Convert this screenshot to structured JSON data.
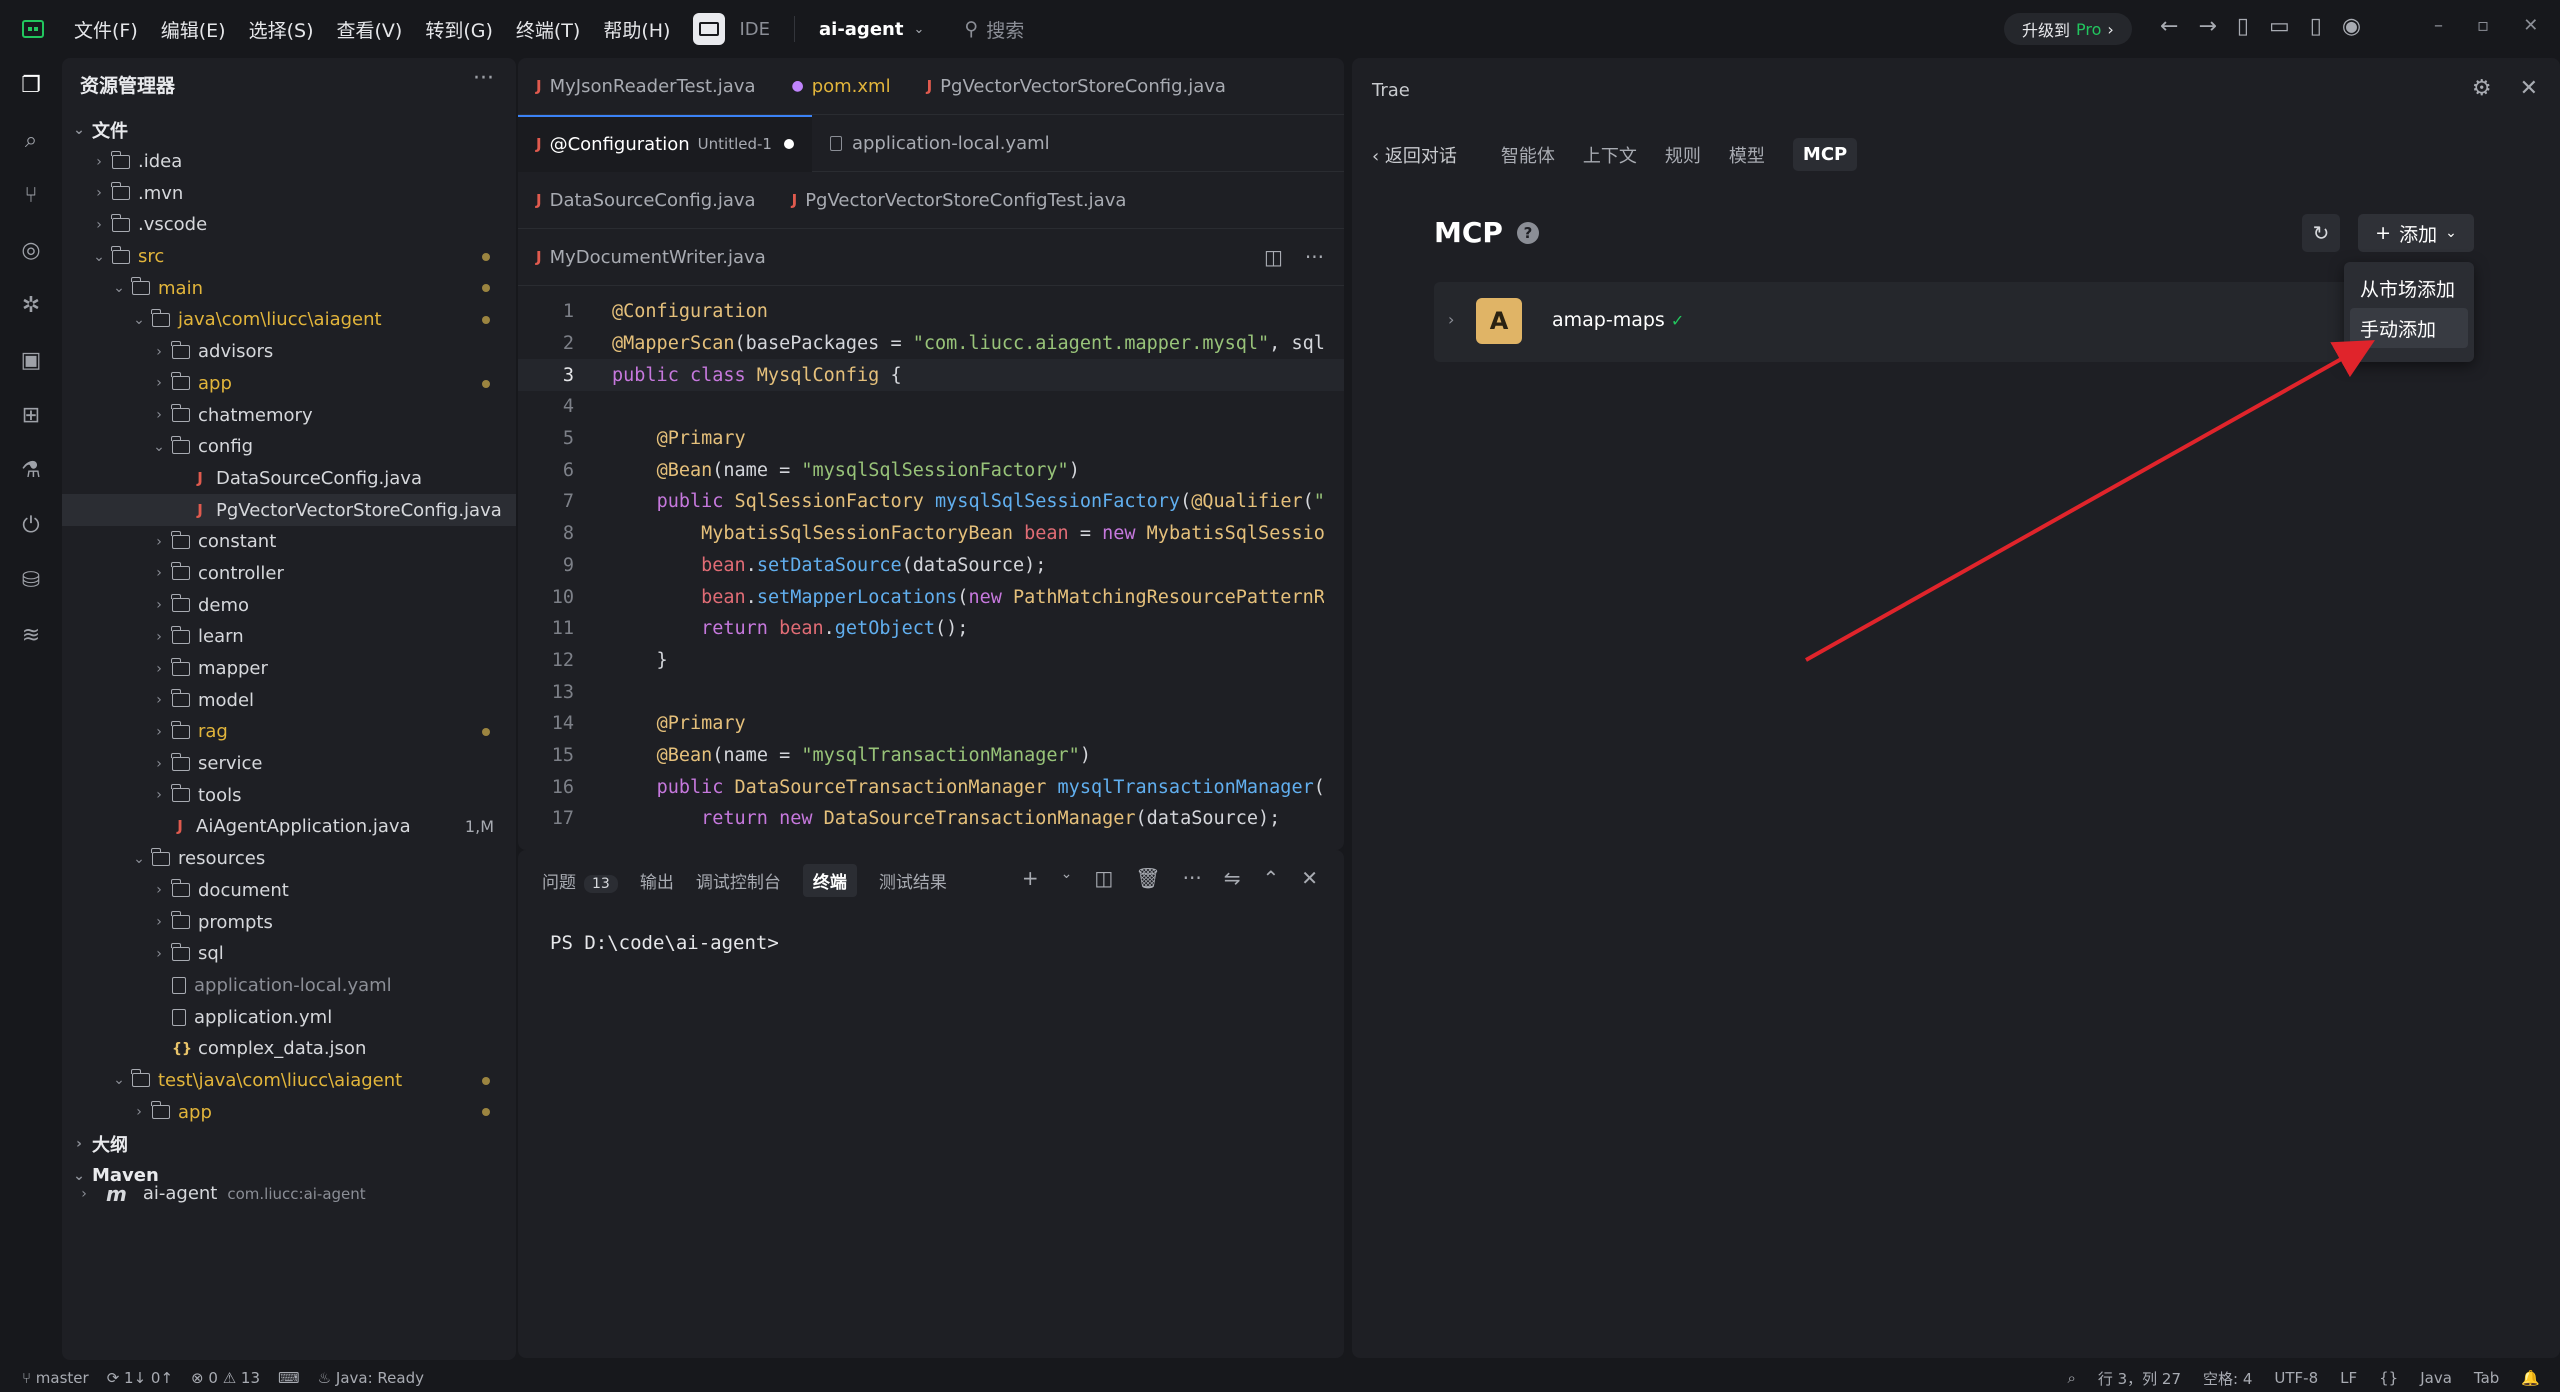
{
  "menu": {
    "items": [
      "文件(F)",
      "编辑(E)",
      "选择(S)",
      "查看(V)",
      "转到(G)",
      "终端(T)",
      "帮助(H)"
    ],
    "ide_label": "IDE",
    "project": "ai-agent",
    "search": "搜索",
    "upgrade_prefix": "升级到",
    "upgrade_pro": "Pro"
  },
  "explorer": {
    "title": "资源管理器",
    "more": "···"
  },
  "tree": [
    {
      "d": 0,
      "c": "⌄",
      "i": "",
      "t": "文件",
      "cls": "sec-row"
    },
    {
      "d": 1,
      "c": "›",
      "i": "fold",
      "t": ".idea"
    },
    {
      "d": 1,
      "c": "›",
      "i": "fold",
      "t": ".mvn"
    },
    {
      "d": 1,
      "c": "›",
      "i": "fold",
      "t": ".vscode"
    },
    {
      "d": 1,
      "c": "⌄",
      "i": "fold",
      "t": "src",
      "cls": "yel",
      "dot": true
    },
    {
      "d": 2,
      "c": "⌄",
      "i": "fold",
      "t": "main",
      "cls": "yel",
      "dot": true
    },
    {
      "d": 3,
      "c": "⌄",
      "i": "fold",
      "t": "java\\com\\liucc\\aiagent",
      "cls": "yel",
      "dot": true
    },
    {
      "d": 4,
      "c": "›",
      "i": "fold",
      "t": "advisors"
    },
    {
      "d": 4,
      "c": "›",
      "i": "fold",
      "t": "app",
      "cls": "yel",
      "dot": true
    },
    {
      "d": 4,
      "c": "›",
      "i": "fold",
      "t": "chatmemory"
    },
    {
      "d": 4,
      "c": "⌄",
      "i": "fold",
      "t": "config"
    },
    {
      "d": 5,
      "c": "",
      "i": "java",
      "t": "DataSourceConfig.java"
    },
    {
      "d": 5,
      "c": "",
      "i": "java",
      "t": "PgVectorVectorStoreConfig.java",
      "sel": true
    },
    {
      "d": 4,
      "c": "›",
      "i": "fold",
      "t": "constant"
    },
    {
      "d": 4,
      "c": "›",
      "i": "fold",
      "t": "controller"
    },
    {
      "d": 4,
      "c": "›",
      "i": "fold",
      "t": "demo"
    },
    {
      "d": 4,
      "c": "›",
      "i": "fold",
      "t": "learn"
    },
    {
      "d": 4,
      "c": "›",
      "i": "fold",
      "t": "mapper"
    },
    {
      "d": 4,
      "c": "›",
      "i": "fold",
      "t": "model"
    },
    {
      "d": 4,
      "c": "›",
      "i": "fold",
      "t": "rag",
      "cls": "yel",
      "dot": true
    },
    {
      "d": 4,
      "c": "›",
      "i": "fold",
      "t": "service"
    },
    {
      "d": 4,
      "c": "›",
      "i": "fold",
      "t": "tools"
    },
    {
      "d": 4,
      "c": "",
      "i": "java",
      "t": "AiAgentApplication.java",
      "badge": "1,M"
    },
    {
      "d": 3,
      "c": "⌄",
      "i": "fold",
      "t": "resources"
    },
    {
      "d": 4,
      "c": "›",
      "i": "fold",
      "t": "document"
    },
    {
      "d": 4,
      "c": "›",
      "i": "fold",
      "t": "prompts"
    },
    {
      "d": 4,
      "c": "›",
      "i": "fold",
      "t": "sql"
    },
    {
      "d": 4,
      "c": "",
      "i": "file",
      "t": "application-local.yaml",
      "cls": "dim"
    },
    {
      "d": 4,
      "c": "",
      "i": "file",
      "t": "application.yml"
    },
    {
      "d": 4,
      "c": "",
      "i": "json",
      "t": "complex_data.json"
    },
    {
      "d": 2,
      "c": "⌄",
      "i": "fold",
      "t": "test\\java\\com\\liucc\\aiagent",
      "cls": "yel",
      "dot": true
    },
    {
      "d": 3,
      "c": "›",
      "i": "fold",
      "t": "app",
      "cls": "yel",
      "dot": true
    },
    {
      "d": 0,
      "c": "›",
      "i": "",
      "t": "大纲",
      "cls": "sec-row"
    },
    {
      "d": 0,
      "c": "⌄",
      "i": "",
      "t": "Maven",
      "cls": "sec-row"
    }
  ],
  "maven": {
    "name": "ai-agent",
    "coord": "com.liucc:ai-agent"
  },
  "editor": {
    "tabs_row1": [
      {
        "label": "MyJsonReaderTest.java",
        "icon": "java"
      },
      {
        "label": "pom.xml",
        "icon": "pom",
        "yellow": true
      },
      {
        "label": "PgVectorVectorStoreConfig.java",
        "icon": "java"
      }
    ],
    "tabs_row2": [
      {
        "label": "@Configuration",
        "sub": "Untitled-1",
        "active": true,
        "modified": true,
        "icon": "java"
      },
      {
        "label": "application-local.yaml",
        "icon": "yaml"
      }
    ],
    "tabs_row3": [
      {
        "label": "DataSourceConfig.java",
        "icon": "java"
      },
      {
        "label": "PgVectorVectorStoreConfigTest.java",
        "icon": "java"
      }
    ],
    "tabs_row4": [
      {
        "label": "MyDocumentWriter.java",
        "icon": "java"
      }
    ],
    "current_line": "3",
    "lines": [
      [
        "1",
        "<span class='an'>@Configuration</span>"
      ],
      [
        "2",
        "<span class='an'>@MapperScan</span>(basePackages = <span class='s'>\"com.liucc.aiagent.mapper.mysql\"</span>, sqlS"
      ],
      [
        "3",
        "<span class='k'>public class</span> <span class='t'>MysqlConfig</span> {"
      ],
      [
        "4",
        ""
      ],
      [
        "5",
        "    <span class='an'>@Primary</span>"
      ],
      [
        "6",
        "    <span class='an'>@Bean</span>(name = <span class='s'>\"mysqlSqlSessionFactory\"</span>)"
      ],
      [
        "7",
        "    <span class='k'>public</span> <span class='t'>SqlSessionFactory</span> <span class='f'>mysqlSqlSessionFactory</span>(<span class='an'>@Qualifier</span>(<span class='s'>\"m</span>"
      ],
      [
        "8",
        "        <span class='t'>MybatisSqlSessionFactoryBean</span> <span class='v'>bean</span> = <span class='k'>new</span> <span class='t'>MybatisSqlSession</span>"
      ],
      [
        "9",
        "        <span class='v'>bean</span>.<span class='f'>setDataSource</span>(dataSource);"
      ],
      [
        "10",
        "        <span class='v'>bean</span>.<span class='f'>setMapperLocations</span>(<span class='k'>new</span> <span class='t'>PathMatchingResourcePatternRe</span>"
      ],
      [
        "11",
        "        <span class='k'>return</span> <span class='v'>bean</span>.<span class='f'>getObject</span>();"
      ],
      [
        "12",
        "    }"
      ],
      [
        "13",
        ""
      ],
      [
        "14",
        "    <span class='an'>@Primary</span>"
      ],
      [
        "15",
        "    <span class='an'>@Bean</span>(name = <span class='s'>\"mysqlTransactionManager\"</span>)"
      ],
      [
        "16",
        "    <span class='k'>public</span> <span class='t'>DataSourceTransactionManager</span> <span class='f'>mysqlTransactionManager</span>(<span class='an'>@</span>"
      ],
      [
        "17",
        "        <span class='k'>return new</span> <span class='t'>DataSourceTransactionManager</span>(dataSource);"
      ]
    ]
  },
  "panel": {
    "tabs": [
      "问题",
      "输出",
      "调试控制台",
      "终端",
      "测试结果"
    ],
    "problems_count": "13",
    "active": "终端",
    "prompt": "PS D:\\code\\ai-agent>"
  },
  "trae": {
    "title": "Trae",
    "back": "返回对话",
    "tabs": [
      "智能体",
      "上下文",
      "规则",
      "模型",
      "MCP"
    ],
    "active_tab": "MCP",
    "heading": "MCP",
    "help": "?",
    "add": "添加",
    "server": {
      "avatar": "A",
      "name": "amap-maps",
      "status": "✓"
    },
    "dropdown": [
      "从市场添加",
      "手动添加"
    ]
  },
  "status": {
    "branch": "master",
    "sync": "1↓ 0↑",
    "errors": "0",
    "warnings": "13",
    "java": "Java: Ready",
    "pos": "行 3，列 27",
    "spaces": "空格: 4",
    "enc": "UTF-8",
    "eol": "LF",
    "braces": "{}",
    "lang": "Java",
    "tab": "Tab"
  },
  "colors": {
    "accent": "#3b82f6",
    "arrow": "#e0242b",
    "pro": "#22c55e",
    "warn": "#e2b53b"
  }
}
